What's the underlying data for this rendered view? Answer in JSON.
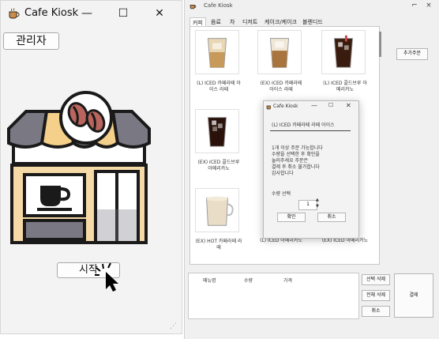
{
  "kiosk_window": {
    "title": "Cafe Kiosk",
    "minimize": "—",
    "maximize": "☐",
    "close": "✕",
    "admin_label": "관리자",
    "start_label": "시작"
  },
  "order_window": {
    "title": "Cafe Kiosk",
    "tabs": [
      "커피",
      "음료",
      "차",
      "디저트",
      "케이크/케이크",
      "블렌디드"
    ],
    "menu_items": [
      {
        "label": "(L) ICED 카페라떼 아이스 라떼"
      },
      {
        "label": "(EX) ICED 카페라떼 아이스 라떼"
      },
      {
        "label": "(L) ICED 콜드브루 아메리카노"
      },
      {
        "label": "(EX) ICED 콜드브루 아메리카노"
      },
      {
        "label": "(EX) HOT 카페라떼 라떼"
      },
      {
        "label": "(L) ICED 아메리카노"
      },
      {
        "label": "(EX) ICED 아메리카노"
      }
    ],
    "side_button": "추가주문",
    "order_columns": [
      "메뉴명",
      "수량",
      "가격"
    ],
    "buttons": {
      "delete": "선택 삭제",
      "clear": "전체 삭제",
      "cancel": "취소",
      "pay": "결제"
    }
  },
  "dialog": {
    "title": "Cafe Kiosk",
    "menu_name": "(L) ICED 카페라떼 라떼 아이스",
    "body_lines": [
      "1개 이상 주문 가능합니다",
      "수량을 선택한 후 확인을",
      "눌러주세요 주문은",
      "결제 후 취소 불가합니다",
      "감사합니다"
    ],
    "qty_label": "수량 선택",
    "qty_value": "1",
    "confirm": "확인",
    "cancel": "취소"
  },
  "colors": {
    "window_bg": "#f3f3f3",
    "awning_stripe": "#f5d08a",
    "awning_dark": "#7a7883",
    "store_body": "#f5d9a6",
    "coffee_brown": "#b9655d",
    "outline": "#1a1a1a"
  }
}
